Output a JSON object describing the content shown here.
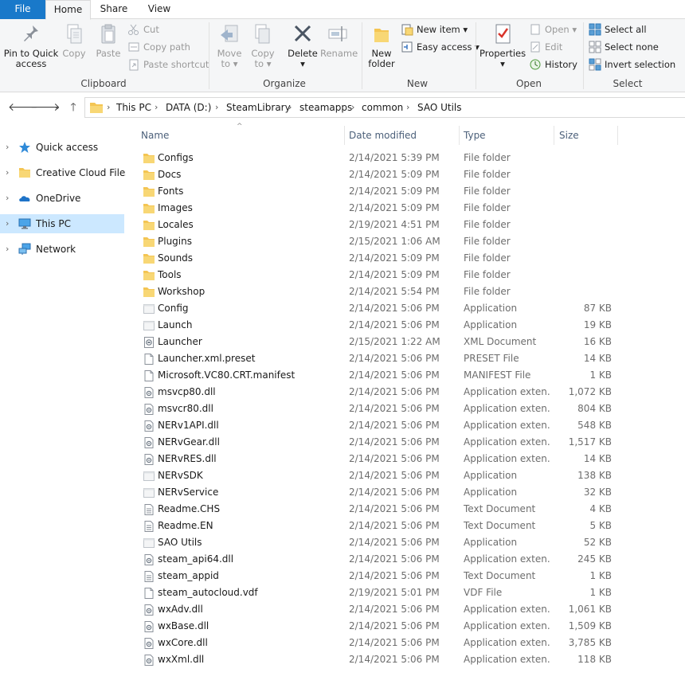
{
  "ribbon_tabs": {
    "file": "File",
    "home": "Home",
    "share": "Share",
    "view": "View"
  },
  "clipboard": {
    "pin": "Pin to Quick access",
    "pin_line1": "Pin to Quick",
    "pin_line2": "access",
    "copy": "Copy",
    "paste": "Paste",
    "cut": "Cut",
    "copy_path": "Copy path",
    "paste_shortcut": "Paste shortcut",
    "group": "Clipboard"
  },
  "organize": {
    "move_to": "Move to",
    "move_line1": "Move",
    "move_line2": "to",
    "copy_to": "Copy to",
    "copy_line1": "Copy",
    "copy_line2": "to",
    "delete": "Delete",
    "rename": "Rename",
    "group": "Organize"
  },
  "new": {
    "new_folder": "New folder",
    "nf_line1": "New",
    "nf_line2": "folder",
    "new_item": "New item",
    "easy_access": "Easy access",
    "group": "New"
  },
  "open": {
    "properties": "Properties",
    "open": "Open",
    "edit": "Edit",
    "history": "History",
    "group": "Open"
  },
  "select": {
    "select_all": "Select all",
    "select_none": "Select none",
    "invert": "Invert selection",
    "group": "Select"
  },
  "breadcrumb": [
    "This PC",
    "DATA (D:)",
    "SteamLibrary",
    "steamapps",
    "common",
    "SAO Utils"
  ],
  "nav_pane": [
    {
      "label": "Quick access",
      "icon": "star-icon"
    },
    {
      "label": "Creative Cloud Files",
      "icon": "folder-icon"
    },
    {
      "label": "OneDrive",
      "icon": "cloud-icon"
    },
    {
      "label": "This PC",
      "icon": "monitor-icon",
      "selected": true
    },
    {
      "label": "Network",
      "icon": "network-icon"
    }
  ],
  "columns": {
    "name": "Name",
    "date": "Date modified",
    "type": "Type",
    "size": "Size"
  },
  "files": [
    {
      "name": "Configs",
      "date": "2/14/2021 5:39 PM",
      "type": "File folder",
      "size": "",
      "icon": "folder"
    },
    {
      "name": "Docs",
      "date": "2/14/2021 5:09 PM",
      "type": "File folder",
      "size": "",
      "icon": "folder"
    },
    {
      "name": "Fonts",
      "date": "2/14/2021 5:09 PM",
      "type": "File folder",
      "size": "",
      "icon": "folder"
    },
    {
      "name": "Images",
      "date": "2/14/2021 5:09 PM",
      "type": "File folder",
      "size": "",
      "icon": "folder"
    },
    {
      "name": "Locales",
      "date": "2/19/2021 4:51 PM",
      "type": "File folder",
      "size": "",
      "icon": "folder"
    },
    {
      "name": "Plugins",
      "date": "2/15/2021 1:06 AM",
      "type": "File folder",
      "size": "",
      "icon": "folder"
    },
    {
      "name": "Sounds",
      "date": "2/14/2021 5:09 PM",
      "type": "File folder",
      "size": "",
      "icon": "folder"
    },
    {
      "name": "Tools",
      "date": "2/14/2021 5:09 PM",
      "type": "File folder",
      "size": "",
      "icon": "folder"
    },
    {
      "name": "Workshop",
      "date": "2/14/2021 5:54 PM",
      "type": "File folder",
      "size": "",
      "icon": "folder"
    },
    {
      "name": "Config",
      "date": "2/14/2021 5:06 PM",
      "type": "Application",
      "size": "87 KB",
      "icon": "app"
    },
    {
      "name": "Launch",
      "date": "2/14/2021 5:06 PM",
      "type": "Application",
      "size": "19 KB",
      "icon": "app"
    },
    {
      "name": "Launcher",
      "date": "2/15/2021 1:22 AM",
      "type": "XML Document",
      "size": "16 KB",
      "icon": "xml"
    },
    {
      "name": "Launcher.xml.preset",
      "date": "2/14/2021 5:06 PM",
      "type": "PRESET File",
      "size": "14 KB",
      "icon": "blank"
    },
    {
      "name": "Microsoft.VC80.CRT.manifest",
      "date": "2/14/2021 5:06 PM",
      "type": "MANIFEST File",
      "size": "1 KB",
      "icon": "blank"
    },
    {
      "name": "msvcp80.dll",
      "date": "2/14/2021 5:06 PM",
      "type": "Application exten...",
      "size": "1,072 KB",
      "icon": "dll"
    },
    {
      "name": "msvcr80.dll",
      "date": "2/14/2021 5:06 PM",
      "type": "Application exten...",
      "size": "804 KB",
      "icon": "dll"
    },
    {
      "name": "NERv1API.dll",
      "date": "2/14/2021 5:06 PM",
      "type": "Application exten...",
      "size": "548 KB",
      "icon": "dll"
    },
    {
      "name": "NERvGear.dll",
      "date": "2/14/2021 5:06 PM",
      "type": "Application exten...",
      "size": "1,517 KB",
      "icon": "dll"
    },
    {
      "name": "NERvRES.dll",
      "date": "2/14/2021 5:06 PM",
      "type": "Application exten...",
      "size": "14 KB",
      "icon": "dll"
    },
    {
      "name": "NERvSDK",
      "date": "2/14/2021 5:06 PM",
      "type": "Application",
      "size": "138 KB",
      "icon": "app"
    },
    {
      "name": "NERvService",
      "date": "2/14/2021 5:06 PM",
      "type": "Application",
      "size": "32 KB",
      "icon": "app"
    },
    {
      "name": "Readme.CHS",
      "date": "2/14/2021 5:06 PM",
      "type": "Text Document",
      "size": "4 KB",
      "icon": "text"
    },
    {
      "name": "Readme.EN",
      "date": "2/14/2021 5:06 PM",
      "type": "Text Document",
      "size": "5 KB",
      "icon": "text"
    },
    {
      "name": "SAO Utils",
      "date": "2/14/2021 5:06 PM",
      "type": "Application",
      "size": "52 KB",
      "icon": "app"
    },
    {
      "name": "steam_api64.dll",
      "date": "2/14/2021 5:06 PM",
      "type": "Application exten...",
      "size": "245 KB",
      "icon": "dll"
    },
    {
      "name": "steam_appid",
      "date": "2/14/2021 5:06 PM",
      "type": "Text Document",
      "size": "1 KB",
      "icon": "text"
    },
    {
      "name": "steam_autocloud.vdf",
      "date": "2/19/2021 5:01 PM",
      "type": "VDF File",
      "size": "1 KB",
      "icon": "blank"
    },
    {
      "name": "wxAdv.dll",
      "date": "2/14/2021 5:06 PM",
      "type": "Application exten...",
      "size": "1,061 KB",
      "icon": "dll"
    },
    {
      "name": "wxBase.dll",
      "date": "2/14/2021 5:06 PM",
      "type": "Application exten...",
      "size": "1,509 KB",
      "icon": "dll"
    },
    {
      "name": "wxCore.dll",
      "date": "2/14/2021 5:06 PM",
      "type": "Application exten...",
      "size": "3,785 KB",
      "icon": "dll"
    },
    {
      "name": "wxXml.dll",
      "date": "2/14/2021 5:06 PM",
      "type": "Application exten...",
      "size": "118 KB",
      "icon": "dll"
    }
  ],
  "colors": {
    "accent": "#1979ca",
    "selection": "#cce8ff",
    "folder": "#f8d775",
    "header_text": "#4c607a"
  }
}
